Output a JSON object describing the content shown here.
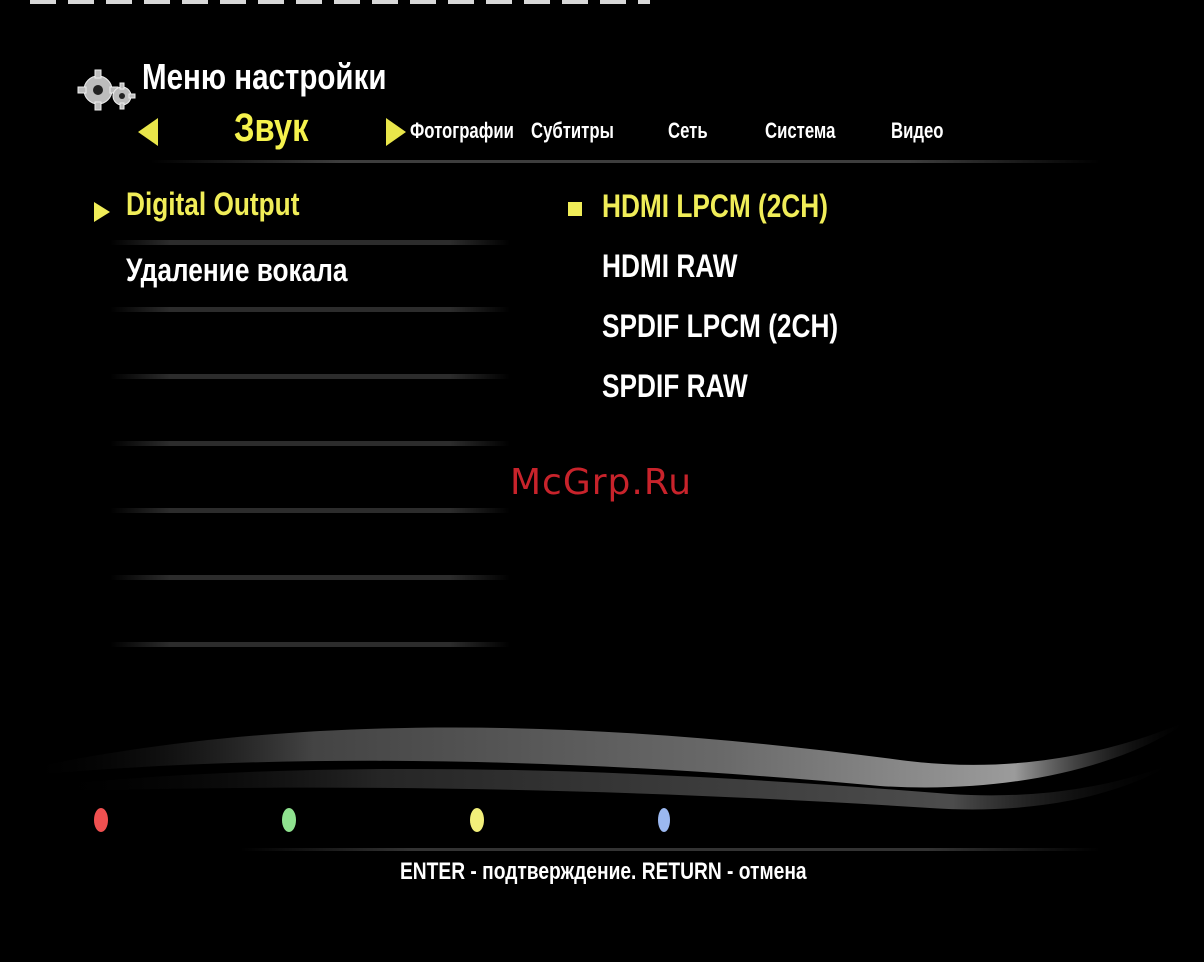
{
  "header": {
    "title": "Меню настройки",
    "icon": "gear-icon"
  },
  "tabs": {
    "active": "Звук",
    "items": [
      "Фотографии",
      "Субтитры",
      "Сеть",
      "Система",
      "Видео"
    ]
  },
  "menu": {
    "items": [
      "Digital Output",
      "Удаление вокала"
    ],
    "selected_index": 0
  },
  "options": {
    "items": [
      "HDMI LPCM (2CH)",
      "HDMI RAW",
      "SPDIF LPCM (2CH)",
      "SPDIF RAW"
    ],
    "selected_index": 0
  },
  "watermark": "McGrp.Ru",
  "color_buttons": {
    "red": "#f05050",
    "green": "#8fe28f",
    "yellow": "#f2ef7a",
    "blue": "#9bb8f0"
  },
  "footer": {
    "hint": "ENTER - подтверждение. RETURN - отмена"
  },
  "colors": {
    "accent": "#f0ed58",
    "background": "#000000"
  }
}
